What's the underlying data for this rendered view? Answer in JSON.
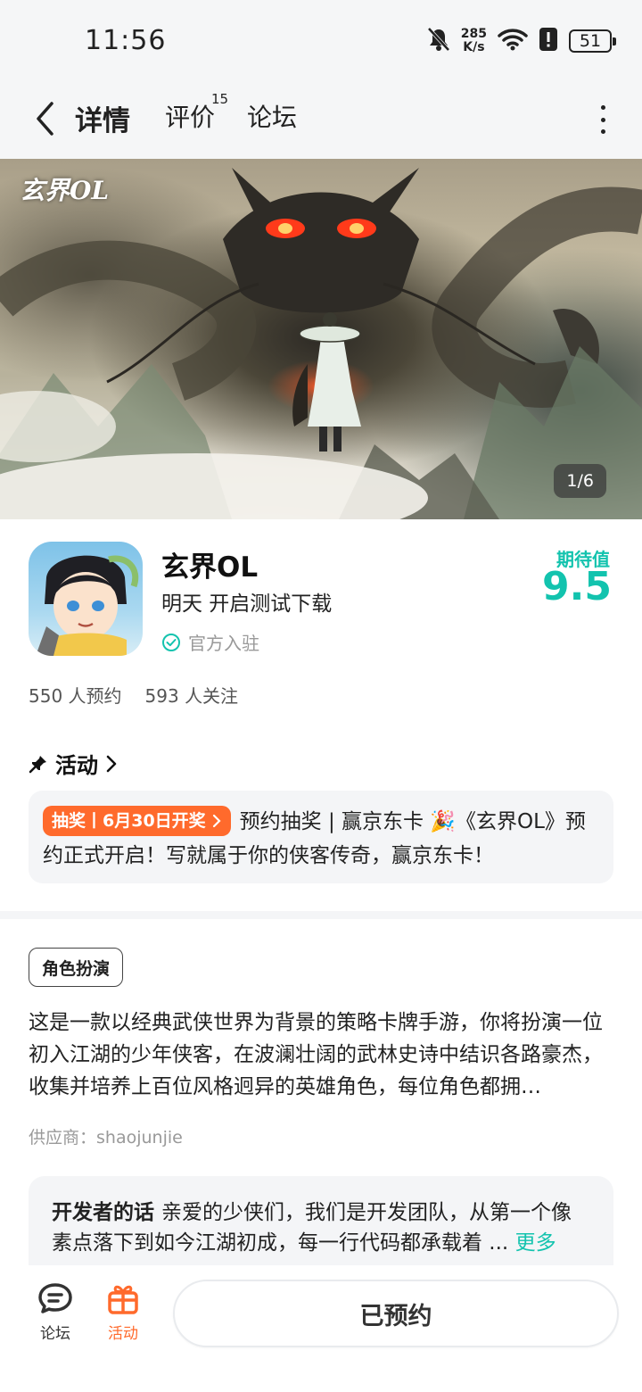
{
  "status_bar": {
    "time": "11:56",
    "net_speed_value": "285",
    "net_speed_unit": "K/s",
    "battery": "51",
    "icons": [
      "mute-icon",
      "wifi-icon",
      "alert-icon",
      "battery-icon"
    ]
  },
  "nav": {
    "tabs": [
      {
        "label": "详情"
      },
      {
        "label": "评价",
        "badge": "15"
      },
      {
        "label": "论坛"
      }
    ]
  },
  "banner": {
    "logo_text": "玄界OL",
    "page_indicator": "1/6"
  },
  "app": {
    "name": "玄界OL",
    "subtitle": "明天 开启测试下载",
    "official": "官方入驻",
    "expect_label": "期待值",
    "expect_value": "9.5",
    "reservations": "550 人预约",
    "followers": "593 人关注"
  },
  "activity": {
    "header": "活动",
    "badge": "抽奖丨6月30日开奖",
    "text": "预约抽奖 | 赢京东卡 🎉《玄界OL》预约正式开启！写就属于你的侠客传奇，赢京东卡！"
  },
  "description": {
    "genre": "角色扮演",
    "text": "这是一款以经典武侠世界为背景的策略卡牌手游，你将扮演一位初入江湖的少年侠客，在波澜壮阔的武林史诗中结识各路豪杰，收集并培养上百位风格迥异的英雄角色，每位角色都拥…",
    "supplier": "供应商：shaojunjie"
  },
  "developer": {
    "title": "开发者的话",
    "text": "亲爱的少侠们，我们是开发团队，从第一个像素点落下到如今江湖初成，每一行代码都承载着 ...",
    "more": "更多"
  },
  "bottom_bar": {
    "forum_label": "论坛",
    "activity_label": "活动",
    "reserve_button": "已预约"
  },
  "colors": {
    "accent": "#13c3ae",
    "orange": "#ff6a2c"
  }
}
